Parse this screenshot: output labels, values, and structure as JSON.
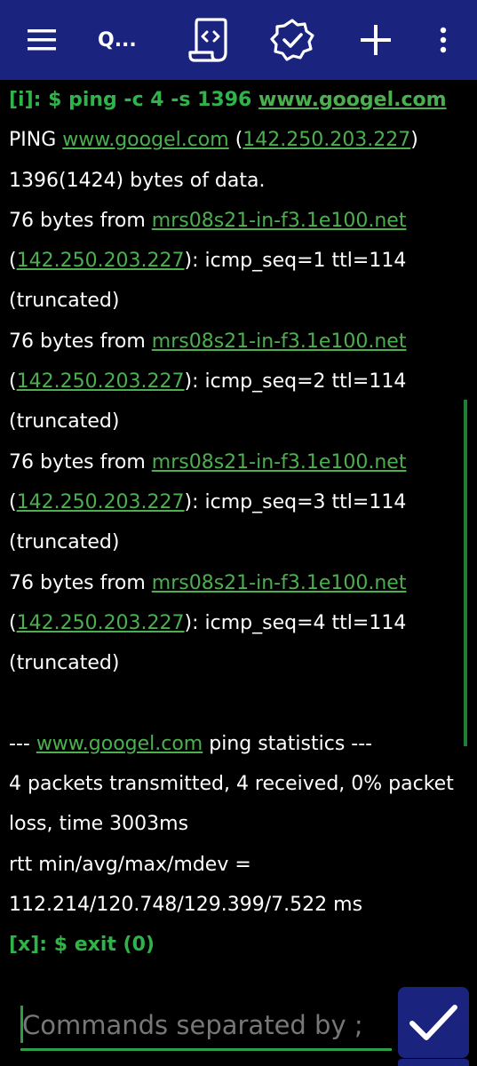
{
  "toolbar": {
    "title": "Q...",
    "icons": [
      "menu-icon",
      "script-icon",
      "verified-badge-icon",
      "add-icon",
      "more-vert-icon"
    ]
  },
  "console": {
    "command_prefix": "[i]: $ ping -c 4 -s 1396 ",
    "command_host": "www.googel.com",
    "ping_prefix": "PING ",
    "ping_host": "www.googel.com",
    "ping_open": " (",
    "ping_ip": "142.250.203.227",
    "ping_close": ")",
    "bytes_line": "1396(1424) bytes of data.",
    "replies": [
      {
        "from": "76 bytes from ",
        "host": "mrs08s21-in-f3.1e100.net",
        "open": "(",
        "ip": "142.250.203.227",
        "rest": "): icmp_seq=1 ttl=114",
        "note": "(truncated)"
      },
      {
        "from": "76 bytes from ",
        "host": "mrs08s21-in-f3.1e100.net",
        "open": "(",
        "ip": "142.250.203.227",
        "rest": "): icmp_seq=2 ttl=114",
        "note": "(truncated)"
      },
      {
        "from": "76 bytes from ",
        "host": "mrs08s21-in-f3.1e100.net",
        "open": "(",
        "ip": "142.250.203.227",
        "rest": "): icmp_seq=3 ttl=114",
        "note": "(truncated)"
      },
      {
        "from": "76 bytes from ",
        "host": "mrs08s21-in-f3.1e100.net",
        "open": "(",
        "ip": "142.250.203.227",
        "rest": "): icmp_seq=4 ttl=114",
        "note": "(truncated)"
      }
    ],
    "stats_prefix": "--- ",
    "stats_host": "www.googel.com",
    "stats_suffix": " ping statistics ---",
    "packets_line1": "4 packets transmitted, 4 received, 0% packet",
    "packets_line2": "loss, time 3003ms",
    "rtt_line1": "rtt min/avg/max/mdev =",
    "rtt_line2": "112.214/120.748/129.399/7.522 ms",
    "exit_line": "[x]: $ exit (0)"
  },
  "input": {
    "placeholder": "Commands separated by ;",
    "value": ""
  },
  "colors": {
    "toolbar": "#1a237e",
    "accent_green": "#2fb34a",
    "link_green": "#4caf50",
    "background": "#000000"
  }
}
